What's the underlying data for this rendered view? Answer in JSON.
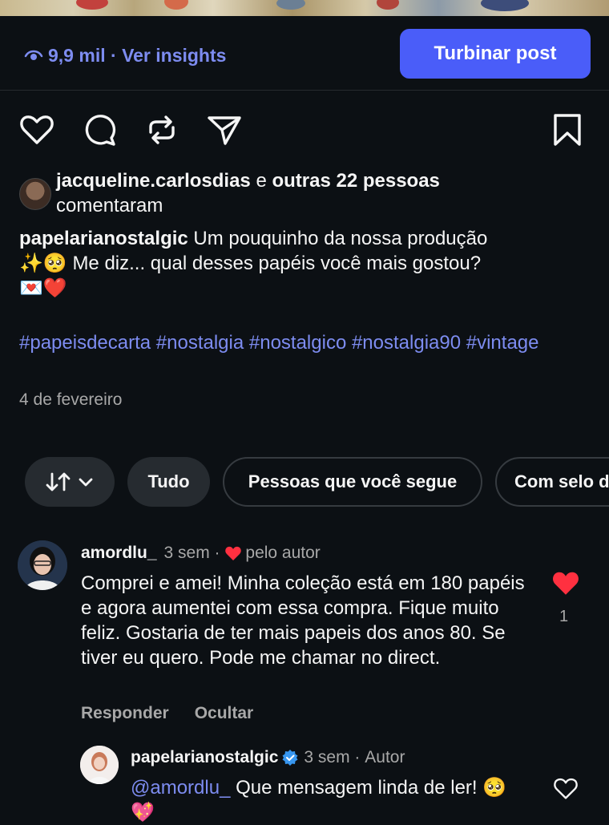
{
  "insights": {
    "views": "9,9 mil",
    "separator": " · ",
    "link": "Ver insights"
  },
  "boost_button": "Turbinar post",
  "commenters": {
    "first": "jacqueline.carlosdias",
    "joiner": " e ",
    "others": "outras 22 pessoas",
    "suffix": "comentaram"
  },
  "caption": {
    "author": "papelarianostalgic",
    "line1": "Um pouquinho da nossa produção",
    "line2_emoji": "✨🥺",
    "line2": "Me diz... qual desses papéis você mais gostou?",
    "line3_emoji": "💌❤️"
  },
  "hashtags": "#papeisdecarta #nostalgia #nostalgico #nostalgia90 #vintage",
  "post_date": "4 de fevereiro",
  "filters": {
    "all": "Tudo",
    "following": "Pessoas que você segue",
    "verified": "Com selo de"
  },
  "comment": {
    "user": "amordlu_",
    "time": "3 sem",
    "separator": " · ",
    "liked_by_author": "pelo autor",
    "text": "Comprei e amei!  Minha coleção está em 180 papéis e agora aumentei com essa compra. Fique muito feliz. Gostaria de ter mais papeis dos anos 80. Se tiver eu quero. Pode me chamar no direct.",
    "reply_label": "Responder",
    "hide_label": "Ocultar",
    "like_count": "1"
  },
  "reply": {
    "user": "papelarianostalgic",
    "time": "3 sem",
    "separator": " · ",
    "role": "Autor",
    "mention": "@amordlu_",
    "text": " Que mensagem linda de ler! ",
    "emoji": "🥺💖"
  },
  "colors": {
    "background": "#0c1014",
    "accent": "#4a5df9",
    "link": "#7d8cf0",
    "like_red": "#ff3040",
    "verified_blue": "#3897f0"
  },
  "icons": [
    "eye-icon",
    "heart-icon",
    "comment-icon",
    "repost-icon",
    "share-icon",
    "bookmark-icon",
    "sort-icon",
    "chevron-down-icon",
    "verified-badge-icon"
  ]
}
